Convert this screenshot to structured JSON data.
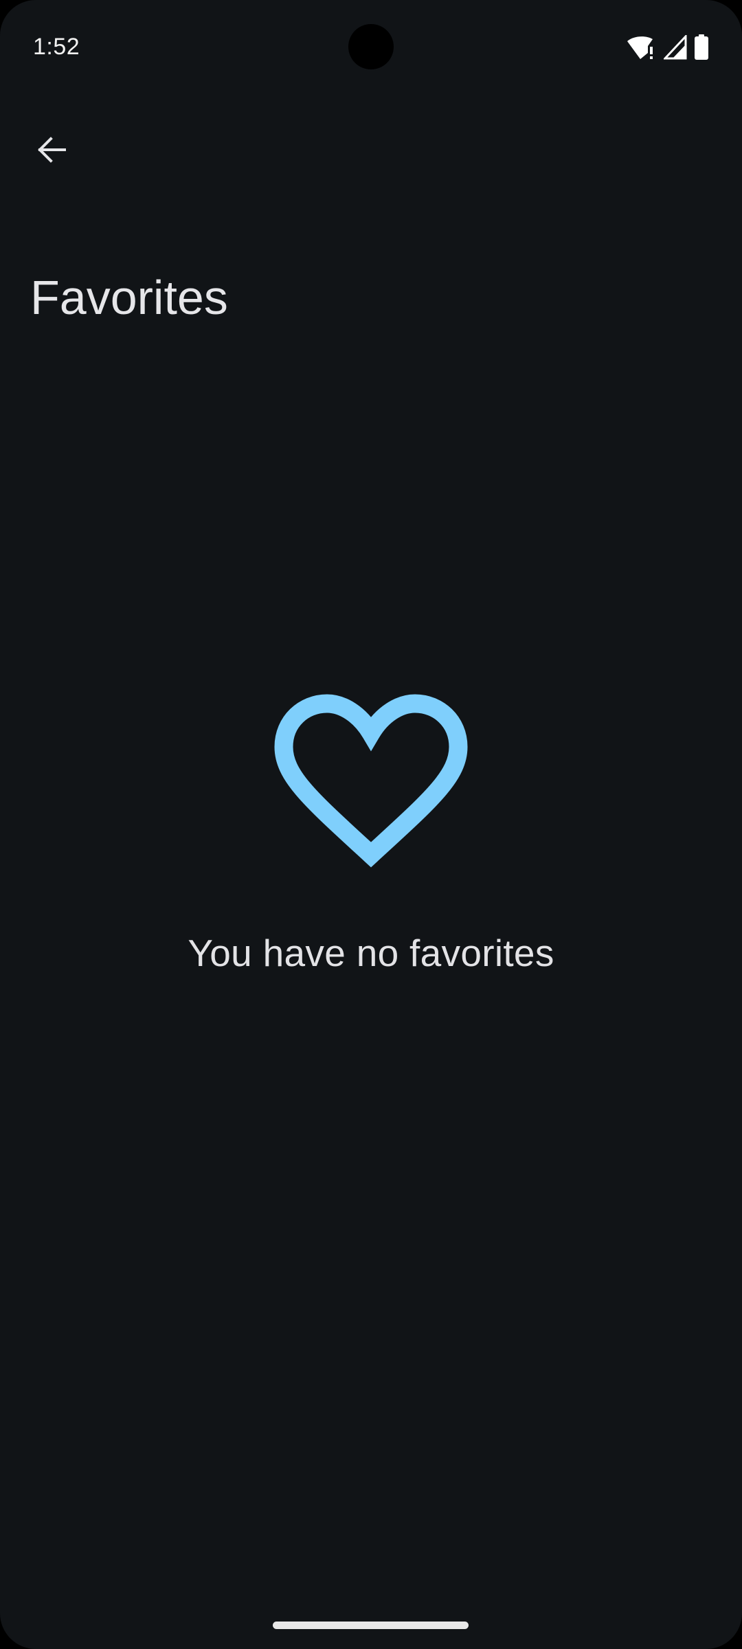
{
  "status_bar": {
    "time": "1:52",
    "icons": [
      "wifi-alert-icon",
      "cellular-signal-icon",
      "battery-icon"
    ]
  },
  "app_bar": {
    "back_icon": "arrow-back-icon",
    "title": "Favorites"
  },
  "empty_state": {
    "icon": "heart-outline-icon",
    "message": "You have no favorites"
  },
  "colors": {
    "background": "#111417",
    "accent": "#7fcffc",
    "text_primary": "#e3e3e6"
  }
}
